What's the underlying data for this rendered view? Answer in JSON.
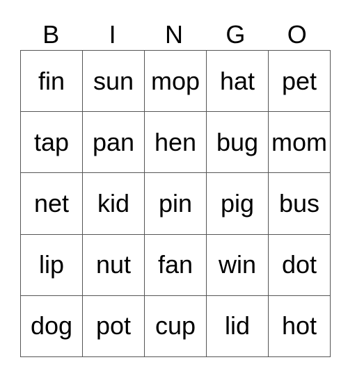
{
  "header": [
    "B",
    "I",
    "N",
    "G",
    "O"
  ],
  "rows": [
    [
      "fin",
      "sun",
      "mop",
      "hat",
      "pet"
    ],
    [
      "tap",
      "pan",
      "hen",
      "bug",
      "mom"
    ],
    [
      "net",
      "kid",
      "pin",
      "pig",
      "bus"
    ],
    [
      "lip",
      "nut",
      "fan",
      "win",
      "dot"
    ],
    [
      "dog",
      "pot",
      "cup",
      "lid",
      "hot"
    ]
  ]
}
